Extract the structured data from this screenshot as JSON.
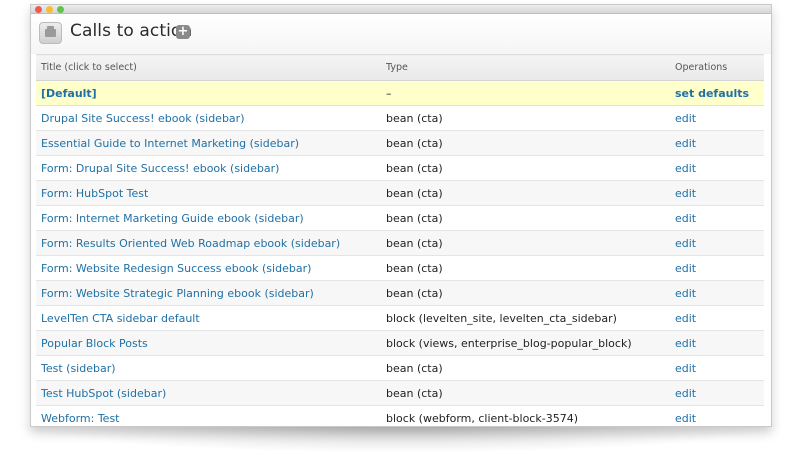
{
  "header": {
    "title": "Calls to action",
    "add_symbol": "+"
  },
  "table": {
    "columns": [
      "Title (click to select)",
      "Type",
      "Operations"
    ],
    "rows": [
      {
        "title": "[Default]",
        "type": "–",
        "op": "set defaults"
      },
      {
        "title": "Drupal Site Success! ebook (sidebar)",
        "type": "bean (cta)",
        "op": "edit"
      },
      {
        "title": "Essential Guide to Internet Marketing (sidebar)",
        "type": "bean (cta)",
        "op": "edit"
      },
      {
        "title": "Form: Drupal Site Success! ebook (sidebar)",
        "type": "bean (cta)",
        "op": "edit"
      },
      {
        "title": "Form: HubSpot Test",
        "type": "bean (cta)",
        "op": "edit"
      },
      {
        "title": "Form: Internet Marketing Guide ebook (sidebar)",
        "type": "bean (cta)",
        "op": "edit"
      },
      {
        "title": "Form: Results Oriented Web Roadmap ebook (sidebar)",
        "type": "bean (cta)",
        "op": "edit"
      },
      {
        "title": "Form: Website Redesign Success ebook (sidebar)",
        "type": "bean (cta)",
        "op": "edit"
      },
      {
        "title": "Form: Website Strategic Planning ebook (sidebar)",
        "type": "bean (cta)",
        "op": "edit"
      },
      {
        "title": "LevelTen CTA sidebar default",
        "type": "block (levelten_site, levelten_cta_sidebar)",
        "op": "edit"
      },
      {
        "title": "Popular Block Posts",
        "type": "block (views, enterprise_blog-popular_block)",
        "op": "edit"
      },
      {
        "title": "Test (sidebar)",
        "type": "bean (cta)",
        "op": "edit"
      },
      {
        "title": "Test HubSpot (sidebar)",
        "type": "bean (cta)",
        "op": "edit"
      },
      {
        "title": "Webform: Test",
        "type": "block (webform, client-block-3574)",
        "op": "edit"
      }
    ]
  },
  "colors": {
    "link": "#1f70a6",
    "highlight_row": "#ffffcc"
  },
  "icons": {
    "header": "block-icon",
    "add": "plus-icon"
  }
}
